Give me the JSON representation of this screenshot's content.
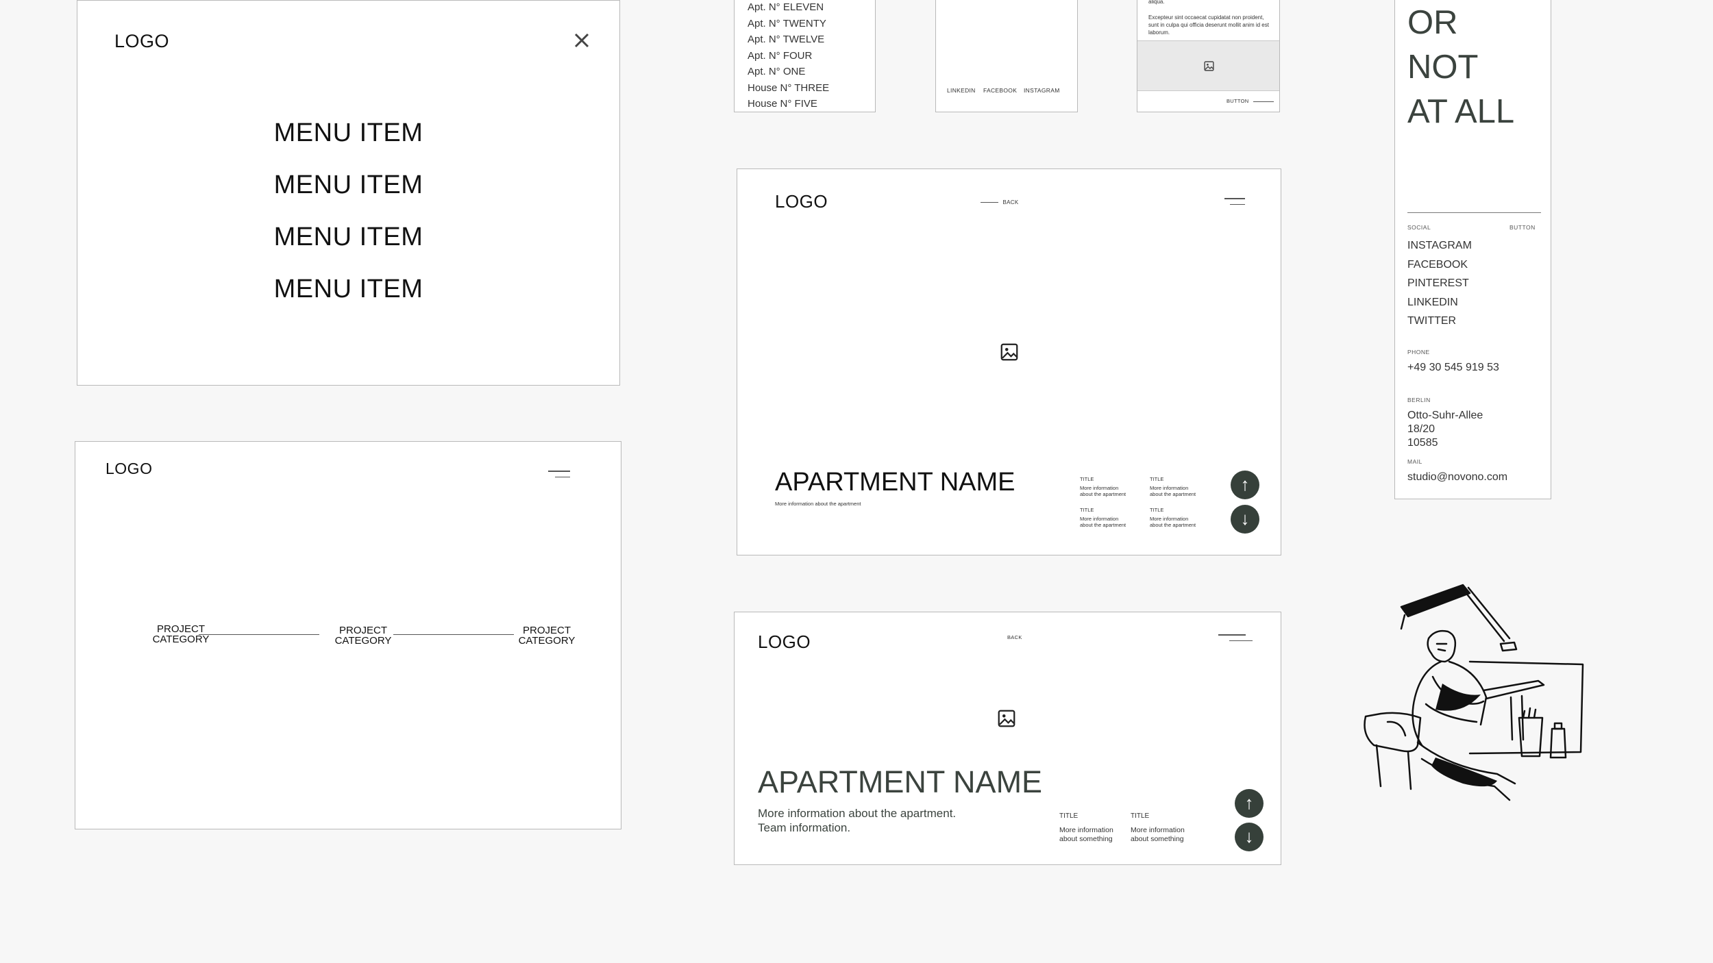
{
  "menu_frame": {
    "logo": "LOGO",
    "close_icon": "close-icon",
    "items": [
      "MENU ITEM",
      "MENU ITEM",
      "MENU ITEM",
      "MENU ITEM"
    ]
  },
  "category_frame": {
    "logo": "LOGO",
    "categories": [
      {
        "line1": "PROJECT",
        "line2": "CATEGORY"
      },
      {
        "line1": "PROJECT",
        "line2": "CATEGORY"
      },
      {
        "line1": "PROJECT",
        "line2": "CATEGORY"
      }
    ]
  },
  "list_frame": {
    "items": [
      "Apt. N° ELEVEN",
      "Apt. N° TWENTY",
      "Apt. N° TWELVE",
      "Apt. N° FOUR",
      "Apt. N° ONE",
      "House N° THREE",
      "House N° FIVE"
    ]
  },
  "social_frame": {
    "links": [
      "LINKEDIN",
      "FACEBOOK",
      "INSTAGRAM"
    ]
  },
  "text_frame": {
    "text_top": "aliqua.",
    "paragraph": "Excepteur sint occaecat cupidatat non proident, sunt in culpa qui officia deserunt mollit anim id est laborum.",
    "button": "BUTTON"
  },
  "apartment_frame_1": {
    "logo": "LOGO",
    "back": "BACK",
    "name": "APARTMENT NAME",
    "sub": "More information about the apartment",
    "info": [
      {
        "title": "TITLE",
        "text1": "More information",
        "text2": "about the apartment"
      },
      {
        "title": "TITLE",
        "text1": "More information",
        "text2": "about the apartment"
      },
      {
        "title": "TITLE",
        "text1": "More information",
        "text2": "about the apartment"
      },
      {
        "title": "TITLE",
        "text1": "More information",
        "text2": "about the apartment"
      }
    ],
    "up_arrow": "↑",
    "down_arrow": "↓"
  },
  "apartment_frame_2": {
    "logo": "LOGO",
    "back": "BACK",
    "name": "APARTMENT NAME",
    "sub1": "More information about the apartment.",
    "sub2": "Team information.",
    "info": [
      {
        "title": "TITLE",
        "text1": "More information",
        "text2": "about something"
      },
      {
        "title": "TITLE",
        "text1": "More information",
        "text2": "about something"
      }
    ],
    "up_arrow": "↑",
    "down_arrow": "↓"
  },
  "contact_frame": {
    "headline": [
      "OR",
      "NOT",
      "AT ALL"
    ],
    "social_label": "SOCIAL",
    "button_label": "BUTTON",
    "socials": [
      "INSTAGRAM",
      "FACEBOOK",
      "PINTEREST",
      "LINKEDIN",
      "TWITTER"
    ],
    "phone_label": "PHONE",
    "phone": "+49 30 545 919 53",
    "city_label": "BERLIN",
    "address": [
      "Otto-Suhr-Allee",
      "18/20",
      "10585"
    ],
    "mail_label": "MAIL",
    "mail": "studio@novono.com"
  },
  "colors": {
    "accent_dark": "#36403a",
    "border": "#b9b9b9",
    "background": "#f7f7f7"
  }
}
